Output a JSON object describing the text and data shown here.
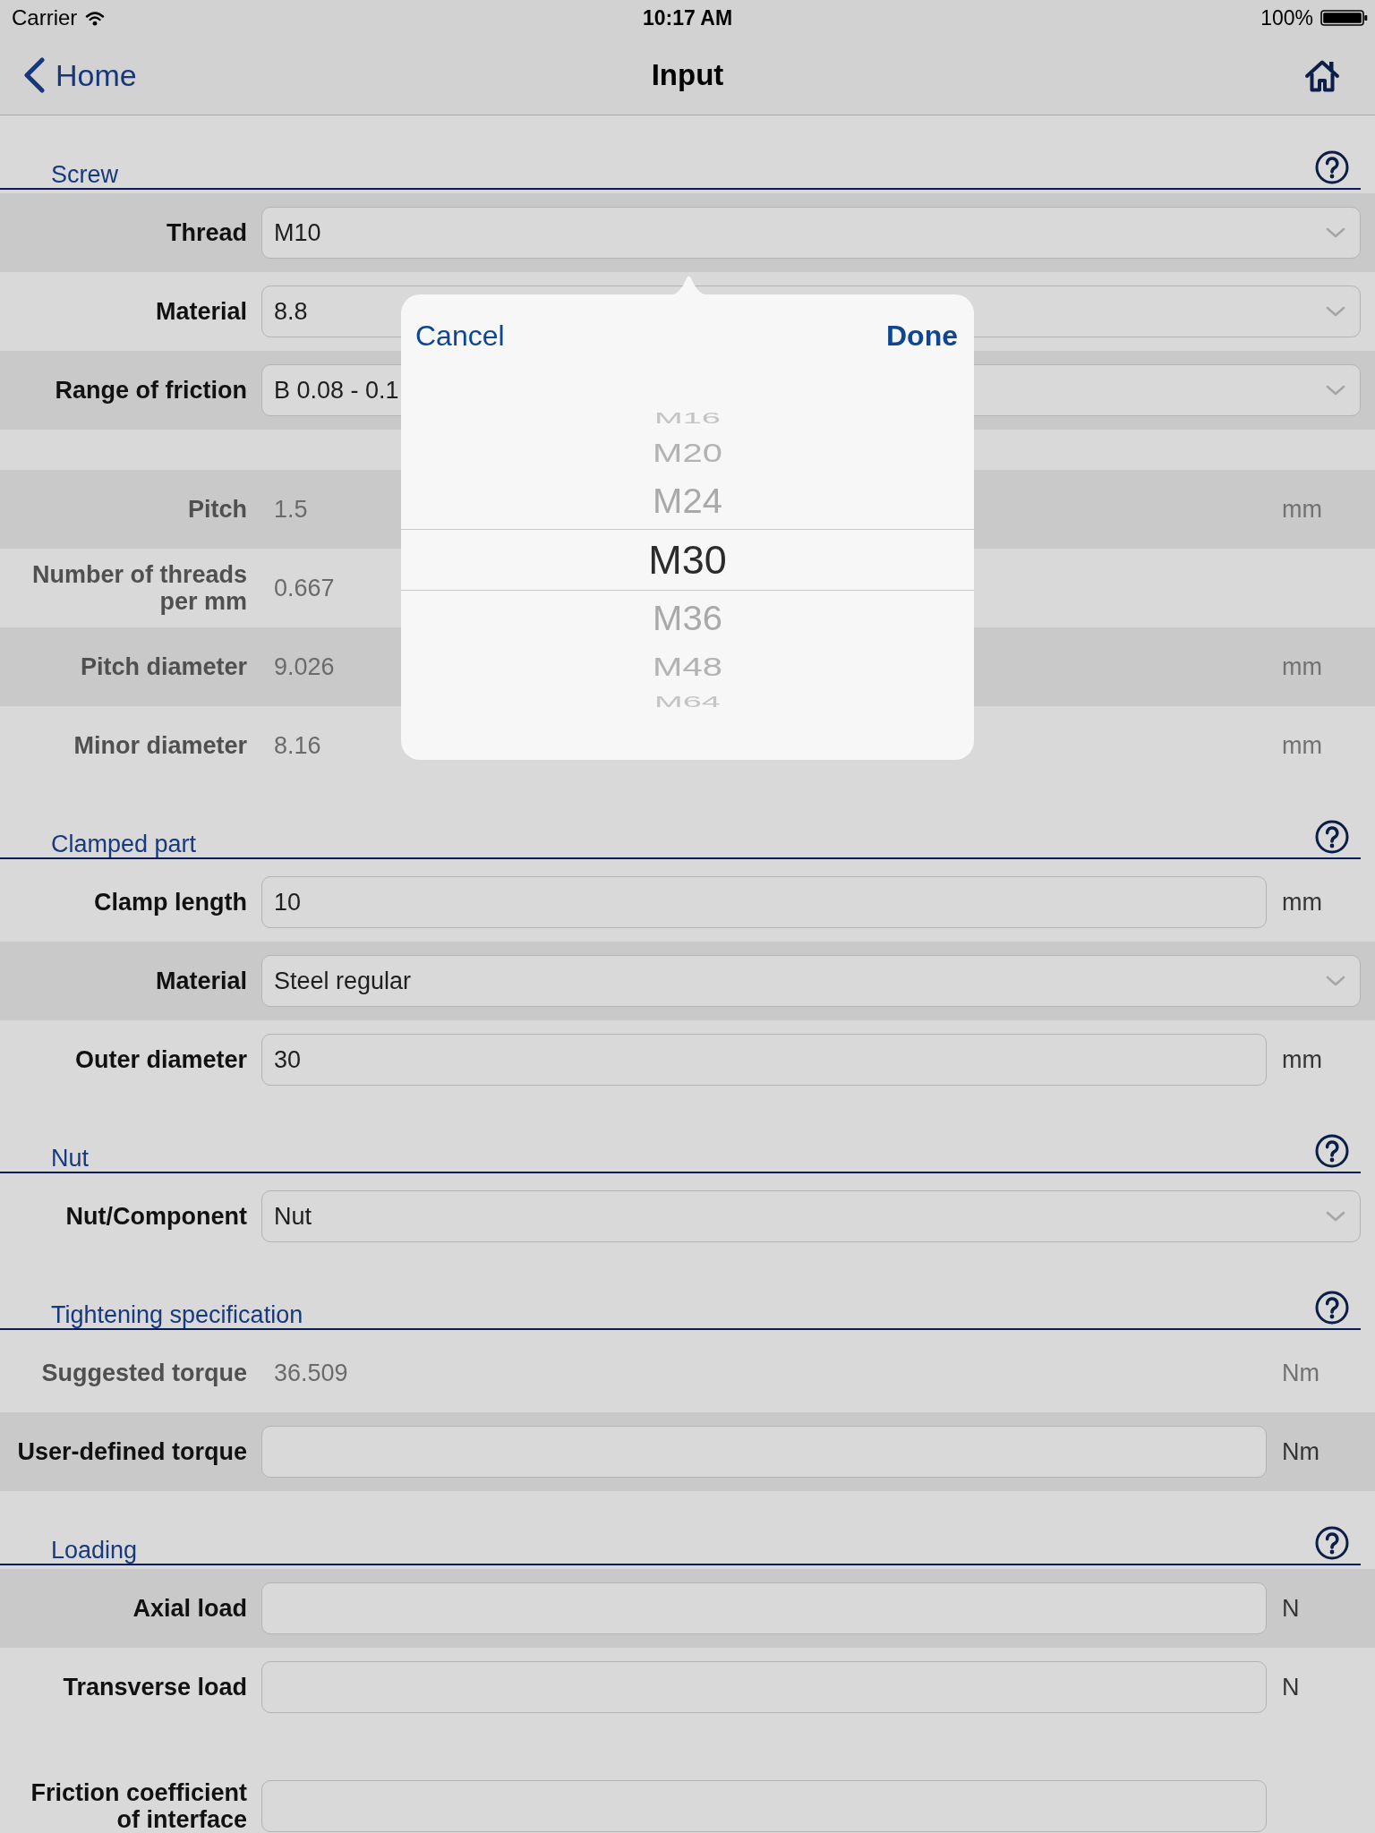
{
  "status_bar": {
    "carrier": "Carrier",
    "time": "10:17 AM",
    "battery": "100%"
  },
  "nav_bar": {
    "back": "Home",
    "title": "Input"
  },
  "sections": [
    {
      "title": "Screw",
      "rows": [
        {
          "kind": "select",
          "label": "Thread",
          "value": "M10",
          "shaded": true
        },
        {
          "kind": "select",
          "label": "Material",
          "value": "8.8",
          "shaded": false
        },
        {
          "kind": "select",
          "label": "Range of friction",
          "value": "B 0.08 - 0.1",
          "shaded": true
        },
        {
          "kind": "readonly",
          "label": "Pitch",
          "value": "1.5",
          "unit": "mm",
          "shaded": true,
          "gap_before": true
        },
        {
          "kind": "readonly",
          "label": "Number of threads per mm",
          "value": "0.667",
          "shaded": false
        },
        {
          "kind": "readonly",
          "label": "Pitch diameter",
          "value": "9.026",
          "unit": "mm",
          "shaded": true
        },
        {
          "kind": "readonly",
          "label": "Minor diameter",
          "value": "8.16",
          "unit": "mm",
          "shaded": false
        }
      ]
    },
    {
      "title": "Clamped part",
      "rows": [
        {
          "kind": "input",
          "label": "Clamp length",
          "value": "10",
          "unit": "mm",
          "shaded": false
        },
        {
          "kind": "select",
          "label": "Material",
          "value": "Steel regular",
          "shaded": true
        },
        {
          "kind": "input",
          "label": "Outer diameter",
          "value": "30",
          "unit": "mm",
          "shaded": false
        }
      ]
    },
    {
      "title": "Nut",
      "rows": [
        {
          "kind": "select",
          "label": "Nut/Component",
          "value": "Nut",
          "shaded": false
        }
      ]
    },
    {
      "title": "Tightening specification",
      "rows": [
        {
          "kind": "readonly",
          "label": "Suggested torque",
          "value": "36.509",
          "unit": "Nm",
          "shaded": false
        },
        {
          "kind": "input",
          "label": "User-defined torque",
          "unit": "Nm",
          "shaded": true
        }
      ]
    },
    {
      "title": "Loading",
      "rows": [
        {
          "kind": "input",
          "label": "Axial load",
          "unit": "N",
          "shaded": true
        },
        {
          "kind": "input",
          "label": "Transverse load",
          "unit": "N",
          "shaded": false
        },
        {
          "kind": "input",
          "label": "Friction coefficient of interface",
          "shaded": false,
          "gap_before": true
        }
      ]
    }
  ],
  "thread_picker": {
    "cancel": "Cancel",
    "done": "Done",
    "options": [
      {
        "label": "M16",
        "selected": false
      },
      {
        "label": "M20",
        "selected": false
      },
      {
        "label": "M24",
        "selected": false
      },
      {
        "label": "M30",
        "selected": true
      },
      {
        "label": "M36",
        "selected": false
      },
      {
        "label": "M48",
        "selected": false
      },
      {
        "label": "M64",
        "selected": false
      }
    ]
  }
}
